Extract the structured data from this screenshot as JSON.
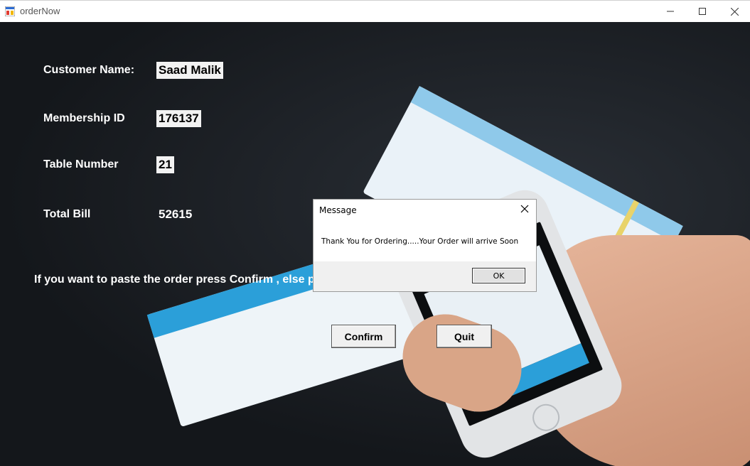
{
  "window": {
    "title": "orderNow",
    "minimize_icon": "minimize-icon",
    "maximize_icon": "maximize-icon",
    "close_icon": "close-icon"
  },
  "form": {
    "customer_name_label": "Customer Name:",
    "customer_name_value": "Saad Malik",
    "membership_label": "Membership ID",
    "membership_value": "176137",
    "table_label": "Table Number",
    "table_value": "21",
    "total_label": "Total Bill",
    "total_value": "52615",
    "instruction": "If you want to paste the order press Confirm , else p",
    "confirm_label": "Confirm",
    "quit_label": "Quit"
  },
  "dialog": {
    "title": "Message",
    "message": "Thank You for Ordering.....Your Order will arrive Soon",
    "ok_label": "OK"
  }
}
